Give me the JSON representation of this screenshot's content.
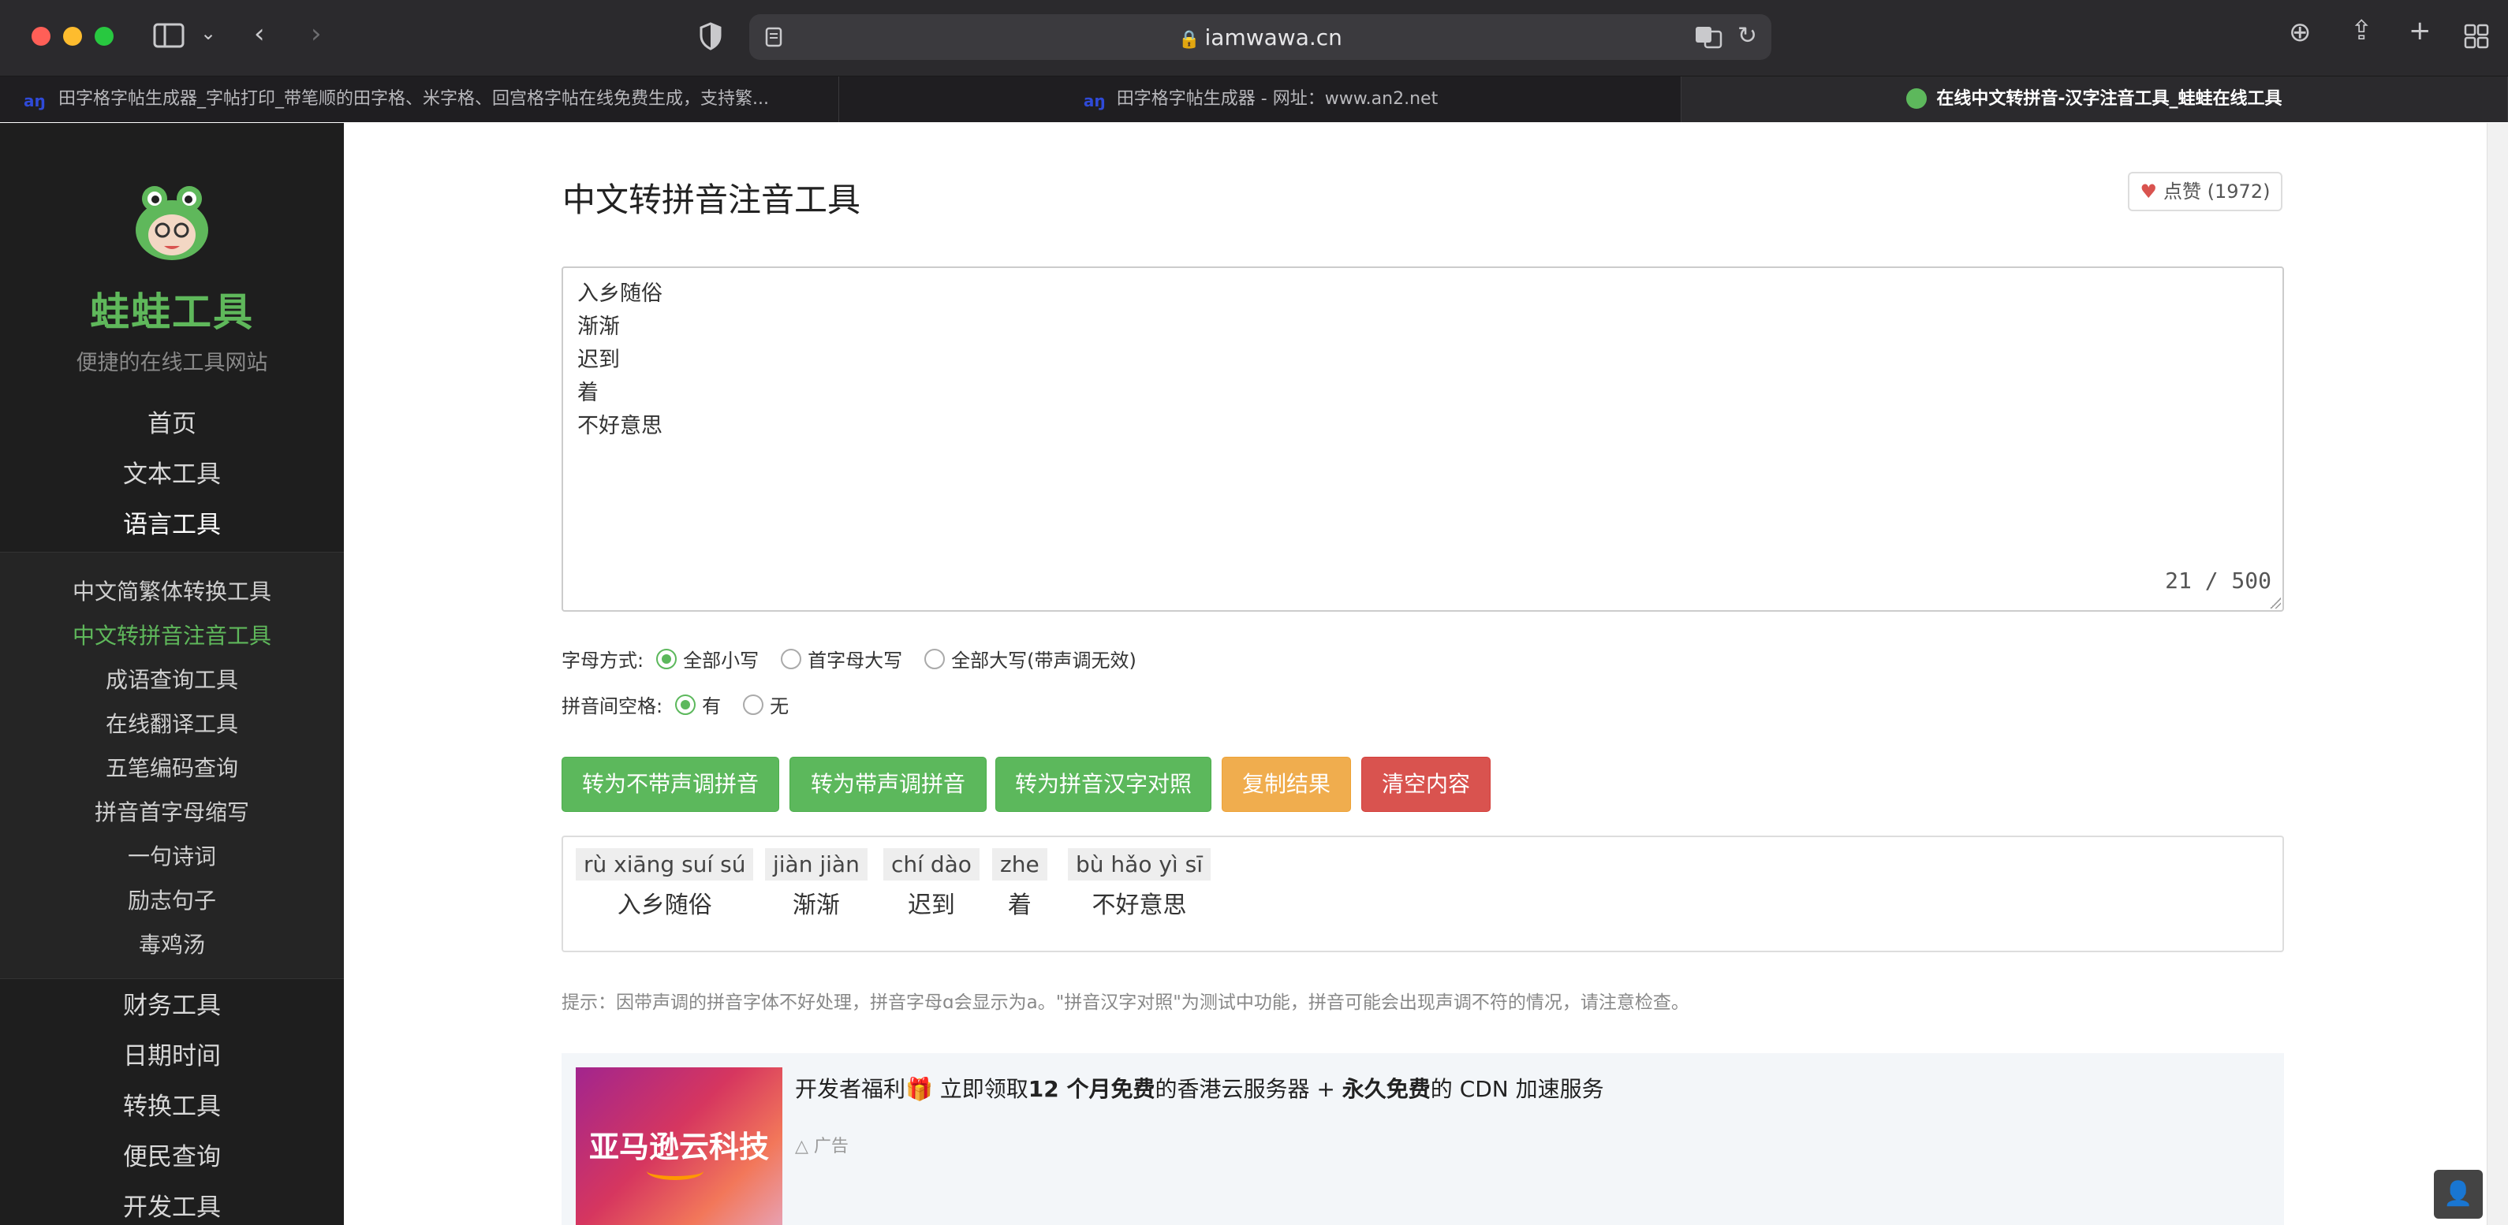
{
  "browser": {
    "url": "iamwawa.cn",
    "tabs": [
      {
        "label": "田字格字帖生成器_字帖打印_带笔顺的田字格、米字格、回宫格字帖在线免费生成，支持繁..."
      },
      {
        "label": "田字格字帖生成器 - 网址：www.an2.net"
      },
      {
        "label": "在线中文转拼音-汉字注音工具_蛙蛙在线工具"
      }
    ],
    "icons": {
      "sidebar_toggle": "sidebar-icon",
      "back": "chevron-left-icon",
      "forward": "chevron-right-icon",
      "shield": "privacy-shield-icon",
      "reader": "reader-icon",
      "lock": "lock-icon",
      "translate": "translate-icon",
      "reload": "reload-icon",
      "download": "download-icon",
      "share": "share-icon",
      "new_tab": "plus-icon",
      "tab_overview": "grid-icon"
    }
  },
  "sidebar": {
    "brand": "蛙蛙工具",
    "tagline": "便捷的在线工具网站",
    "nav_top": [
      {
        "label": "首页"
      },
      {
        "label": "文本工具"
      },
      {
        "label": "语言工具"
      }
    ],
    "sub_items": [
      {
        "label": "中文简繁体转换工具"
      },
      {
        "label": "中文转拼音注音工具"
      },
      {
        "label": "成语查询工具"
      },
      {
        "label": "在线翻译工具"
      },
      {
        "label": "五笔编码查询"
      },
      {
        "label": "拼音首字母缩写"
      },
      {
        "label": "一句诗词"
      },
      {
        "label": "励志句子"
      },
      {
        "label": "毒鸡汤"
      }
    ],
    "nav_bottom": [
      {
        "label": "财务工具"
      },
      {
        "label": "日期时间"
      },
      {
        "label": "转换工具"
      },
      {
        "label": "便民查询"
      },
      {
        "label": "开发工具"
      }
    ]
  },
  "main": {
    "title": "中文转拼音注音工具",
    "like_label": "点赞 (1972)",
    "input_lines": [
      "入乡随俗",
      "渐渐",
      "迟到",
      "着",
      "不好意思"
    ],
    "char_counter": "21 / 500",
    "letter_mode": {
      "label": "字母方式:",
      "options": [
        {
          "label": "全部小写",
          "selected": true
        },
        {
          "label": "首字母大写",
          "selected": false
        },
        {
          "label": "全部大写(带声调无效)",
          "selected": false
        }
      ]
    },
    "spacing": {
      "label": "拼音间空格:",
      "options": [
        {
          "label": "有",
          "selected": true
        },
        {
          "label": "无",
          "selected": false
        }
      ]
    },
    "buttons": {
      "no_tone": "转为不带声调拼音",
      "with_tone": "转为带声调拼音",
      "compare": "转为拼音汉字对照",
      "copy": "复制结果",
      "clear": "清空内容"
    },
    "results": [
      {
        "pinyin": "rù xiāng suí sú",
        "hanzi": "入乡随俗"
      },
      {
        "pinyin": "jiàn jiàn",
        "hanzi": "渐渐"
      },
      {
        "pinyin": "chí dào",
        "hanzi": "迟到"
      },
      {
        "pinyin": "zhe",
        "hanzi": "着"
      },
      {
        "pinyin": "bù hǎo yì sī",
        "hanzi": "不好意思"
      }
    ],
    "hint": "提示：因带声调的拼音字体不好处理，拼音字母ɑ会显示为a。\"拼音汉字对照\"为测试中功能，拼音可能会出现声调不符的情况，请注意检查。",
    "ad": {
      "image_text": "亚马逊云科技",
      "text_parts": [
        "开发者福利",
        " 立即领取",
        "12 个月免费",
        "的香港云服务器 + ",
        "永久免费",
        "的 CDN 加速服务"
      ],
      "tag": "广告"
    }
  },
  "colors": {
    "accent_green": "#5cb85c",
    "orange": "#f0ad4e",
    "red": "#d9534f",
    "sidebar_bg": "#1e1e1e",
    "brand_green": "#5fb85b"
  }
}
